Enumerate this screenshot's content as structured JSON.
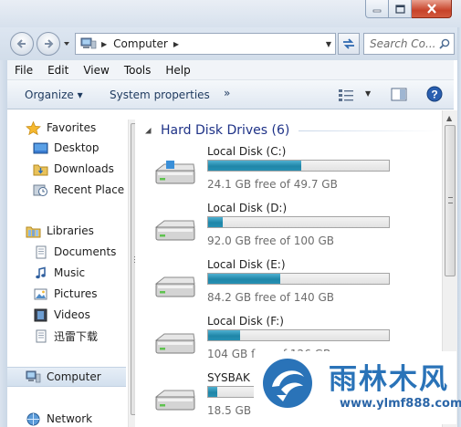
{
  "window": {
    "address": {
      "location": "Computer"
    },
    "search": {
      "placeholder": "Search Co..."
    }
  },
  "menu": [
    "File",
    "Edit",
    "View",
    "Tools",
    "Help"
  ],
  "toolbar": {
    "organize": "Organize ▾",
    "system_properties": "System properties",
    "more": "»"
  },
  "nav": {
    "favorites": {
      "label": "Favorites",
      "items": [
        "Desktop",
        "Downloads",
        "Recent Place"
      ]
    },
    "libraries": {
      "label": "Libraries",
      "items": [
        "Documents",
        "Music",
        "Pictures",
        "Videos",
        "迅雷下载"
      ]
    },
    "computer": {
      "label": "Computer"
    },
    "network": {
      "label": "Network"
    }
  },
  "content": {
    "group_title": "Hard Disk Drives (6)",
    "drives": [
      {
        "name": "Local Disk (C:)",
        "free_text": "24.1 GB free of 49.7 GB",
        "used_fraction": 0.515
      },
      {
        "name": "Local Disk (D:)",
        "free_text": "92.0 GB free of 100 GB",
        "used_fraction": 0.08
      },
      {
        "name": "Local Disk (E:)",
        "free_text": "84.2 GB free of 140 GB",
        "used_fraction": 0.4
      },
      {
        "name": "Local Disk (F:)",
        "free_text": "104 GB free of 126 GB",
        "used_fraction": 0.175
      },
      {
        "name": "SYSBAK (",
        "free_text": "18.5 GB",
        "used_fraction": 0.05
      }
    ]
  },
  "watermark": {
    "name": "雨林木风",
    "url": "www.ylmf888.com"
  },
  "colors": {
    "drive_fill": "#1f86a8",
    "group_title": "#1e3287",
    "watermark_blue": "#2a73b8"
  }
}
